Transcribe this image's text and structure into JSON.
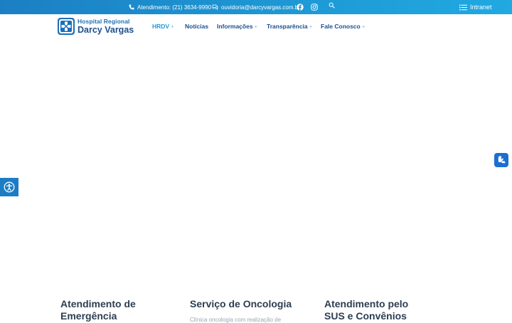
{
  "topbar": {
    "phone_text": "Atendimento: (21) 3634-9990",
    "email_text": "ouvidoria@darcyvargas.com.br",
    "intranet_label": "Intranet",
    "icons": [
      "phone-icon",
      "chat-icon",
      "facebook-icon",
      "instagram-icon",
      "search-icon",
      "list-icon"
    ]
  },
  "header": {
    "logo_line1": "Hospital Regional",
    "logo_line2": "Darcy Vargas",
    "nav": [
      {
        "label": "HRDV",
        "caret": "+"
      },
      {
        "label": "Notícias",
        "caret": ""
      },
      {
        "label": "Informações",
        "caret": "+"
      },
      {
        "label": "Transparência",
        "caret": "+"
      },
      {
        "label": "Fale Conosco",
        "caret": "+"
      }
    ]
  },
  "services": [
    {
      "title_line1": "Atendimento de",
      "title_line2": "Emergência",
      "desc": ""
    },
    {
      "title_line1": "Serviço de Oncologia",
      "title_line2": "",
      "desc": "Clínica oncologia com realização de"
    },
    {
      "title_line1": "Atendimento pelo",
      "title_line2": "SUS e Convênios",
      "desc": ""
    }
  ],
  "colors": {
    "topbar": "#1e9ad6",
    "nav_text": "#1d4f8c",
    "nav_active": "#1e9ad6",
    "accessibility_button": "#1c7dc4",
    "libras_button": "#1c6fd0"
  },
  "widgets": {
    "accessibility_icon": "accessibility-icon",
    "libras_icon": "sign-language-hand-icon"
  }
}
